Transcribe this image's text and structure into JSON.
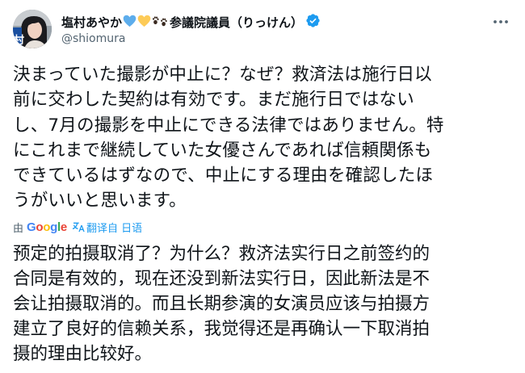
{
  "author": {
    "display_name": "塩村あやか",
    "title_suffix": "参議院議員（りっけん）",
    "handle": "@shiomura",
    "avatar_caption": "村"
  },
  "tweet": {
    "lines": [
      "決まっていた撮影が中止に？なぜ？救済法は施行日以",
      "前に交わした契約は有効です。まだ施行日ではない",
      "し、7月の撮影を中止にできる法律ではありません。特",
      "にこれまで継続していた女優さんであれば信頼関係も",
      "できているはずなので、中止にする理由を確認したほ",
      "うがいいと思います。"
    ]
  },
  "translation": {
    "by_label": "由",
    "provider": "Google",
    "link_label": "翻译自 日语",
    "lines": [
      "预定的拍摄取消了？为什么？救济法实行日之前签约的",
      "合同是有效的，现在还没到新法实行日，因此新法是不",
      "会让拍摄取消的。而且长期参演的女演员应该与拍摄方",
      "建立了良好的信赖关系，我觉得还是再确认一下取消拍",
      "摄的理由比较好。"
    ]
  },
  "colors": {
    "text": "#0f1419",
    "secondary": "#536471",
    "link": "#1d9bf0",
    "verified": "#1d9bf0",
    "google_blue": "#4285f4",
    "google_red": "#ea4335",
    "google_yellow": "#fbbc05",
    "google_green": "#34a853"
  },
  "icons": {
    "blue_heart": "blue-heart-icon",
    "yellow_heart": "yellow-heart-icon",
    "paw": "paw-prints-icon",
    "verified": "verified-badge-icon",
    "more": "more-options-icon",
    "translate": "translate-icon"
  }
}
